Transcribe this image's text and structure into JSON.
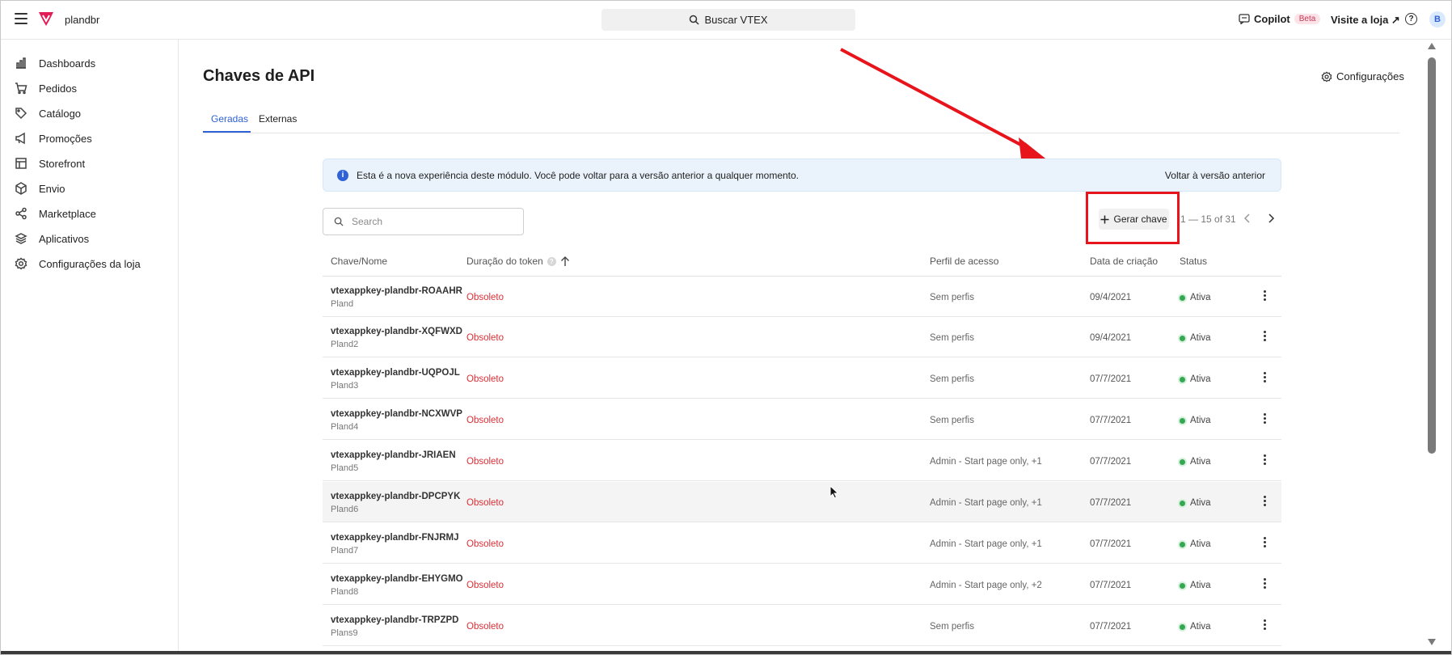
{
  "topbar": {
    "store_name": "plandbr",
    "search_label": "Buscar VTEX",
    "copilot_label": "Copilot",
    "beta_badge": "Beta",
    "visit_store": "Visite a loja ↗",
    "help_glyph": "?",
    "avatar_initial": "B"
  },
  "sidebar": {
    "items": [
      {
        "label": "Dashboards",
        "icon": "bar-chart-icon"
      },
      {
        "label": "Pedidos",
        "icon": "cart-icon"
      },
      {
        "label": "Catálogo",
        "icon": "tag-icon"
      },
      {
        "label": "Promoções",
        "icon": "megaphone-icon"
      },
      {
        "label": "Storefront",
        "icon": "layout-icon"
      },
      {
        "label": "Envio",
        "icon": "box-icon"
      },
      {
        "label": "Marketplace",
        "icon": "share-nodes-icon"
      },
      {
        "label": "Aplicativos",
        "icon": "layers-icon"
      },
      {
        "label": "Configurações da loja",
        "icon": "gear-icon"
      }
    ]
  },
  "main": {
    "title": "Chaves de API",
    "config_link": "Configurações",
    "tabs": [
      {
        "label": "Geradas",
        "active": true
      },
      {
        "label": "Externas",
        "active": false
      }
    ],
    "banner": {
      "message": "Esta é a nova experiência deste módulo. Você pode voltar para a versão anterior a qualquer momento.",
      "back_link": "Voltar à versão anterior"
    },
    "search_placeholder": "Search",
    "generate_button": "Gerar chave",
    "pagination": "1 — 15 of 31"
  },
  "table": {
    "columns": [
      "Chave/Nome",
      "Duração do token",
      "Perfil de acesso",
      "Data de criação",
      "Status"
    ],
    "rows": [
      {
        "key": "vtexappkey-plandbr-ROAAHR",
        "name": "Pland",
        "duration": "Obsoleto",
        "profile": "Sem perfis",
        "date": "09/4/2021",
        "status": "Ativa"
      },
      {
        "key": "vtexappkey-plandbr-XQFWXD",
        "name": "Pland2",
        "duration": "Obsoleto",
        "profile": "Sem perfis",
        "date": "09/4/2021",
        "status": "Ativa"
      },
      {
        "key": "vtexappkey-plandbr-UQPOJL",
        "name": "Pland3",
        "duration": "Obsoleto",
        "profile": "Sem perfis",
        "date": "07/7/2021",
        "status": "Ativa"
      },
      {
        "key": "vtexappkey-plandbr-NCXWVP",
        "name": "Pland4",
        "duration": "Obsoleto",
        "profile": "Sem perfis",
        "date": "07/7/2021",
        "status": "Ativa"
      },
      {
        "key": "vtexappkey-plandbr-JRIAEN",
        "name": "Pland5",
        "duration": "Obsoleto",
        "profile": "Admin - Start page only, +1",
        "date": "07/7/2021",
        "status": "Ativa"
      },
      {
        "key": "vtexappkey-plandbr-DPCPYK",
        "name": "Pland6",
        "duration": "Obsoleto",
        "profile": "Admin - Start page only, +1",
        "date": "07/7/2021",
        "status": "Ativa"
      },
      {
        "key": "vtexappkey-plandbr-FNJRMJ",
        "name": "Pland7",
        "duration": "Obsoleto",
        "profile": "Admin - Start page only, +1",
        "date": "07/7/2021",
        "status": "Ativa"
      },
      {
        "key": "vtexappkey-plandbr-EHYGMO",
        "name": "Pland8",
        "duration": "Obsoleto",
        "profile": "Admin - Start page only, +2",
        "date": "07/7/2021",
        "status": "Ativa"
      },
      {
        "key": "vtexappkey-plandbr-TRPZPD",
        "name": "Plans9",
        "duration": "Obsoleto",
        "profile": "Sem perfis",
        "date": "07/7/2021",
        "status": "Ativa"
      }
    ]
  },
  "colors": {
    "accent": "#2f62d6",
    "obsolete": "#dc2f36",
    "active": "#34a853",
    "annotation": "#e8141c"
  }
}
